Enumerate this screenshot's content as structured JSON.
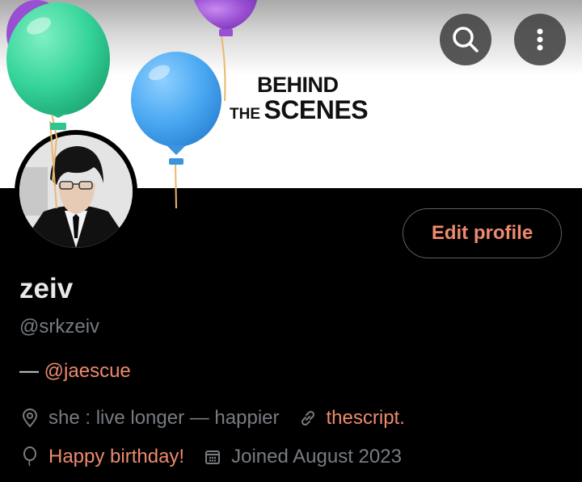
{
  "banner": {
    "line1": "BEHIND",
    "line2_the": "THE",
    "line2_scenes": "SCENES"
  },
  "header": {
    "search_icon": "search-icon",
    "more_icon": "more-vertical-icon"
  },
  "profile": {
    "edit_label": "Edit profile",
    "name": "zeiv",
    "handle": "@srkzeiv",
    "bio_prefix": "— ",
    "bio_mention": "@jaescue",
    "location": "she : live longer — happier",
    "website": "thescript.",
    "birthday": "Happy birthday!",
    "joined": "Joined August 2023"
  },
  "colors": {
    "accent": "#ee8a6e",
    "muted": "#777c82",
    "text": "#e8e8e8",
    "background": "#000000"
  }
}
